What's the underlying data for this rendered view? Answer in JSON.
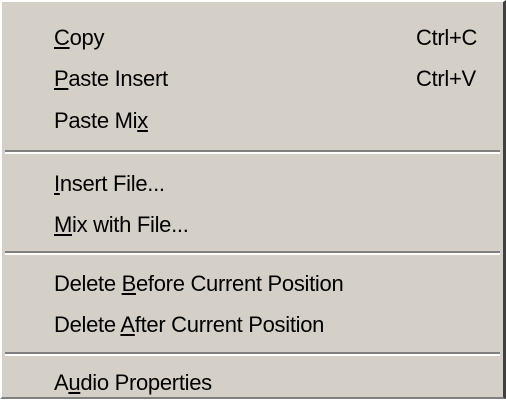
{
  "menu": {
    "groups": [
      {
        "items": [
          {
            "pre": "",
            "key": "C",
            "post": "opy",
            "shortcut": "Ctrl+C"
          },
          {
            "pre": "",
            "key": "P",
            "post": "aste Insert",
            "shortcut": "Ctrl+V"
          },
          {
            "pre": "Paste Mi",
            "key": "x",
            "post": "",
            "shortcut": ""
          }
        ]
      },
      {
        "items": [
          {
            "pre": "",
            "key": "I",
            "post": "nsert File...",
            "shortcut": ""
          },
          {
            "pre": "",
            "key": "M",
            "post": "ix with File...",
            "shortcut": ""
          }
        ]
      },
      {
        "items": [
          {
            "pre": "Delete ",
            "key": "B",
            "post": "efore Current Position",
            "shortcut": ""
          },
          {
            "pre": "Delete ",
            "key": "A",
            "post": "fter Current Position",
            "shortcut": ""
          }
        ]
      },
      {
        "items": [
          {
            "pre": "A",
            "key": "u",
            "post": "dio Properties",
            "shortcut": ""
          }
        ]
      }
    ]
  }
}
